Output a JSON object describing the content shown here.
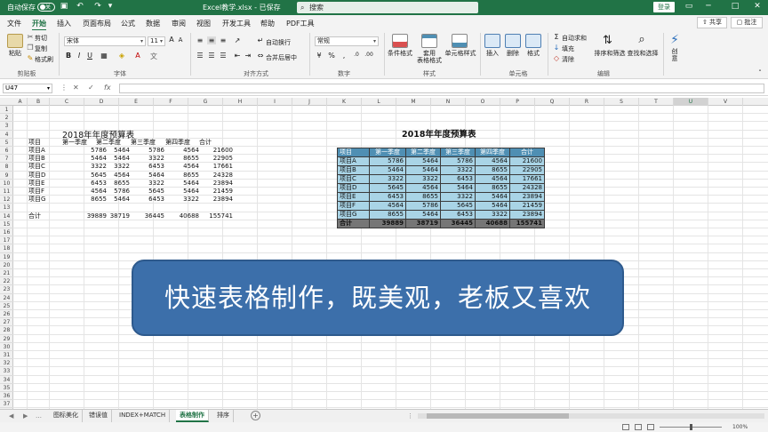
{
  "window": {
    "autosave_label": "自动保存",
    "autosave_state": "关",
    "doc_title": "Excel教学.xlsx - 已保存",
    "search_placeholder": "搜索",
    "login_label": "登录"
  },
  "menu": {
    "tabs": [
      "文件",
      "开始",
      "插入",
      "页面布局",
      "公式",
      "数据",
      "审阅",
      "视图",
      "开发工具",
      "帮助",
      "PDF工具"
    ],
    "active_tab": "开始",
    "share_label": "共享",
    "comment_label": "批注"
  },
  "ribbon": {
    "clipboard": {
      "paste": "粘贴",
      "cut": "剪切",
      "copy": "复制",
      "format_painter": "格式刷",
      "label": "剪贴板"
    },
    "font": {
      "name": "宋体",
      "size": "11",
      "bold": "B",
      "italic": "I",
      "underline": "U",
      "label": "字体"
    },
    "alignment": {
      "wrap": "自动换行",
      "merge": "合并后居中",
      "label": "对齐方式"
    },
    "number": {
      "format": "常规",
      "label": "数字"
    },
    "styles": {
      "conditional": "条件格式",
      "table": "套用\n表格格式",
      "cell_styles": "单元格样式",
      "label": "样式"
    },
    "cells": {
      "insert": "插入",
      "delete": "删除",
      "format": "格式",
      "label": "单元格"
    },
    "editing": {
      "autosum": "自动求和",
      "fill": "填充",
      "clear": "清除",
      "sort": "排序和筛选",
      "find": "查找和选择",
      "label": "编辑"
    },
    "creative": {
      "label": "创\n意"
    }
  },
  "formula_bar": {
    "name_box": "U47",
    "cancel": "✕",
    "enter": "✓",
    "fx": "fx",
    "content": ""
  },
  "columns": [
    "A",
    "B",
    "C",
    "D",
    "E",
    "F",
    "G",
    "H",
    "I",
    "J",
    "K",
    "L",
    "M",
    "N",
    "O",
    "P",
    "Q",
    "R",
    "S",
    "T",
    "U",
    "V"
  ],
  "selected_column": "U",
  "rows": [
    "1",
    "2",
    "3",
    "4",
    "5",
    "6",
    "7",
    "8",
    "9",
    "10",
    "11",
    "12",
    "13",
    "14",
    "15",
    "16",
    "17",
    "18",
    "19",
    "20",
    "21",
    "22",
    "23",
    "24",
    "25",
    "26",
    "27",
    "28",
    "29",
    "30",
    "31",
    "32",
    "33",
    "34",
    "35",
    "36",
    "37",
    "38"
  ],
  "left_table": {
    "title": "2018年年度预算表",
    "headers": [
      "项目",
      "第一季度",
      "第二季度",
      "第三季度",
      "第四季度",
      "合计"
    ],
    "rows": [
      [
        "项目A",
        "5786",
        "5464",
        "5786",
        "4564",
        "21600"
      ],
      [
        "项目B",
        "5464",
        "5464",
        "3322",
        "8655",
        "22905"
      ],
      [
        "项目C",
        "3322",
        "3322",
        "6453",
        "4564",
        "17661"
      ],
      [
        "项目D",
        "5645",
        "4564",
        "5464",
        "8655",
        "24328"
      ],
      [
        "项目E",
        "6453",
        "8655",
        "3322",
        "5464",
        "23894"
      ],
      [
        "项目F",
        "4564",
        "5786",
        "5645",
        "5464",
        "21459"
      ],
      [
        "项目G",
        "8655",
        "5464",
        "6453",
        "3322",
        "23894"
      ]
    ],
    "total": [
      "合计",
      "39889",
      "38719",
      "36445",
      "40688",
      "155741"
    ]
  },
  "right_table": {
    "title": "2018年年度预算表",
    "headers": [
      "项目",
      "第一季度",
      "第二季度",
      "第三季度",
      "第四季度",
      "合计"
    ],
    "rows": [
      [
        "项目A",
        "5786",
        "5464",
        "5786",
        "4564",
        "21600"
      ],
      [
        "项目B",
        "5464",
        "5464",
        "3322",
        "8655",
        "22905"
      ],
      [
        "项目C",
        "3322",
        "3322",
        "6453",
        "4564",
        "17661"
      ],
      [
        "项目D",
        "5645",
        "4564",
        "5464",
        "8655",
        "24328"
      ],
      [
        "项目E",
        "6453",
        "8655",
        "3322",
        "5464",
        "23894"
      ],
      [
        "项目F",
        "4564",
        "5786",
        "5645",
        "5464",
        "21459"
      ],
      [
        "项目G",
        "8655",
        "5464",
        "6453",
        "3322",
        "23894"
      ]
    ],
    "total": [
      "合计",
      "39889",
      "38719",
      "36445",
      "40688",
      "155741"
    ],
    "colors": {
      "header": "#4f8fb3",
      "body": "#a9d4e6",
      "total": "#767676"
    }
  },
  "banner": {
    "text": "快速表格制作，既美观，老板又喜欢",
    "color": "#3c6faa"
  },
  "sheets": {
    "tabs": [
      "图标美化",
      "错误值",
      "INDEX+MATCH",
      "表格制作",
      "排序"
    ],
    "active": "表格制作"
  },
  "status": {
    "zoom": "100%"
  },
  "colors": {
    "brand": "#217346"
  }
}
